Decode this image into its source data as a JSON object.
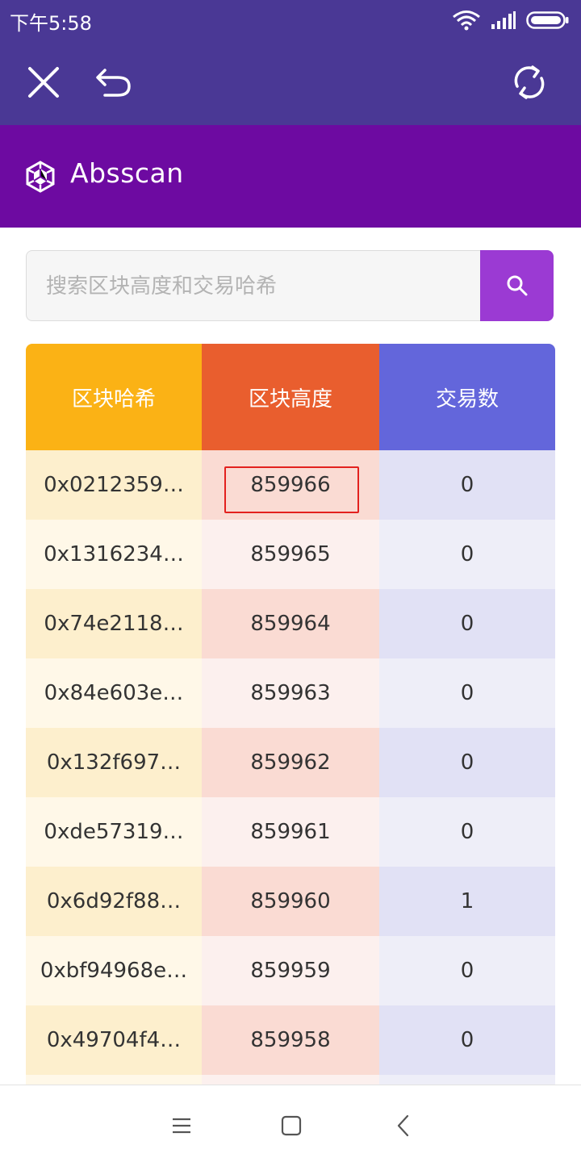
{
  "status_bar": {
    "time": "下午5:58"
  },
  "header": {
    "title": "Absscan"
  },
  "search": {
    "placeholder": "搜索区块高度和交易哈希"
  },
  "table": {
    "columns": [
      "区块哈希",
      "区块高度",
      "交易数"
    ],
    "rows": [
      {
        "hash": "0x0212359…",
        "height": "859966",
        "tx_count": "0"
      },
      {
        "hash": "0x1316234…",
        "height": "859965",
        "tx_count": "0"
      },
      {
        "hash": "0x74e2118…",
        "height": "859964",
        "tx_count": "0"
      },
      {
        "hash": "0x84e603e…",
        "height": "859963",
        "tx_count": "0"
      },
      {
        "hash": "0x132f697…",
        "height": "859962",
        "tx_count": "0"
      },
      {
        "hash": "0xde57319…",
        "height": "859961",
        "tx_count": "0"
      },
      {
        "hash": "0x6d92f88…",
        "height": "859960",
        "tx_count": "1"
      },
      {
        "hash": "0xbf94968e…",
        "height": "859959",
        "tx_count": "0"
      },
      {
        "hash": "0x49704f4…",
        "height": "859958",
        "tx_count": "0"
      }
    ]
  },
  "colors": {
    "toolbar": "#4a3895",
    "header": "#6d0aa1",
    "search_button": "#9b3ad3",
    "col_hash": "#fbb215",
    "col_height": "#e95e2e",
    "col_tx": "#6366db",
    "highlight": "#e3211f"
  },
  "icons": {
    "toolbar": [
      "close-icon",
      "undo-icon",
      "refresh-icon"
    ],
    "header": "logo-icon",
    "search": "search-icon",
    "status": [
      "wifi-icon",
      "signal-icon",
      "battery-icon"
    ],
    "nav": [
      "menu-icon",
      "home-icon",
      "back-icon"
    ]
  }
}
